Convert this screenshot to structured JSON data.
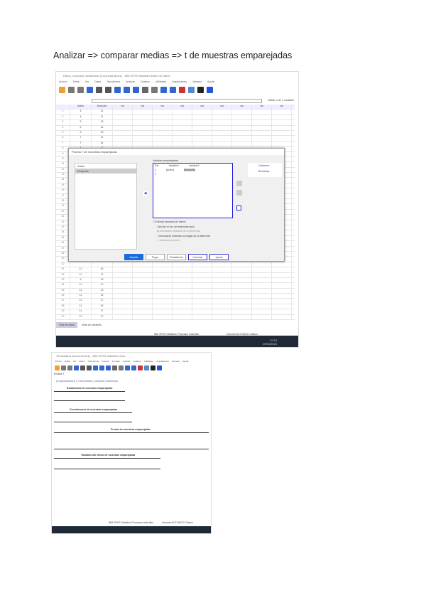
{
  "title": "Analizar => comparar medias =>  t de muestras emparejadas",
  "screenshot1": {
    "window_title": "Datos_comparar medias.sav [ConjuntoDatos1] - IBM SPSS Statistics Editor de datos",
    "menu": [
      "Archivo",
      "Editar",
      "Ver",
      "Datos",
      "Transformar",
      "Analizar",
      "Gráficos",
      "Utilidades",
      "Ampliaciones",
      "Ventana",
      "Ayuda"
    ],
    "visible_label": "Visible: 2 de 2 variables",
    "columns": [
      "Antes",
      "Después",
      "var",
      "var",
      "var",
      "var",
      "var",
      "var",
      "var",
      "var",
      "var"
    ],
    "rows": [
      [
        "1",
        "4",
        "11"
      ],
      [
        "2",
        "4",
        "11"
      ],
      [
        "3",
        "5",
        "13"
      ],
      [
        "4",
        "9",
        "14"
      ],
      [
        "5",
        "9",
        "13"
      ],
      [
        "6",
        "7",
        "11"
      ],
      [
        "7",
        "7",
        "14"
      ],
      [
        "8",
        "4",
        "17"
      ],
      [
        "9",
        "",
        ""
      ],
      [
        "10",
        "",
        ""
      ],
      [
        "11",
        "",
        ""
      ],
      [
        "12",
        "",
        ""
      ],
      [
        "13",
        "",
        ""
      ],
      [
        "14",
        "",
        ""
      ],
      [
        "15",
        "",
        ""
      ],
      [
        "16",
        "",
        ""
      ],
      [
        "17",
        "",
        ""
      ],
      [
        "18",
        "",
        ""
      ],
      [
        "19",
        "",
        ""
      ],
      [
        "20",
        "",
        ""
      ],
      [
        "21",
        "",
        ""
      ],
      [
        "22",
        "",
        ""
      ],
      [
        "23",
        "",
        ""
      ],
      [
        "24",
        "",
        ""
      ],
      [
        "25",
        "",
        ""
      ],
      [
        "26",
        "",
        ""
      ],
      [
        "27",
        "",
        ""
      ],
      [
        "28",
        "",
        ""
      ],
      [
        "29",
        "",
        ""
      ],
      [
        "30",
        "",
        ""
      ],
      [
        "31",
        "11",
        "16"
      ],
      [
        "32",
        "11",
        "17"
      ],
      [
        "33",
        "9",
        "13"
      ],
      [
        "34",
        "11",
        "17"
      ],
      [
        "35",
        "11",
        "13"
      ],
      [
        "36",
        "11",
        "14"
      ],
      [
        "37",
        "11",
        "17"
      ],
      [
        "38",
        "11",
        "16"
      ],
      [
        "39",
        "11",
        "17"
      ],
      [
        "40",
        "11",
        "17"
      ]
    ],
    "tabs": [
      "Vista de datos",
      "Vista de variables"
    ],
    "status": "IBM SPSS Statistics Processor está listo",
    "status_right": "Unicode:ACTIVADO  Clásico",
    "dialog": {
      "title": "Prueba T de muestras emparejadas",
      "source_vars": [
        "Antes",
        "Después"
      ],
      "pairs_label": "Variables emparejadas:",
      "pair_headers": [
        "Par",
        "Variable1",
        "Variable2"
      ],
      "pairs": [
        [
          "1",
          "[Antes]",
          "[Después]"
        ],
        [
          "2",
          "",
          ""
        ]
      ],
      "options_button": "Opciones...",
      "bootstrap_button": "Bootstrap...",
      "effect_checkbox": "Estimar tamaños del efecto",
      "effect_group_label": "Calcular el uso del estandarizador",
      "radios": [
        "Desviación estándar de la diferencia",
        "Desviación estándar corregida de la diferencia",
        "Varianza promedio"
      ],
      "buttons": [
        "Aceptar",
        "Pegar",
        "Restablecer",
        "Cancelar",
        "Ayuda"
      ]
    },
    "taskbar_time": "12:15",
    "taskbar_date": "20/04/2024"
  },
  "screenshot2": {
    "window_title": "*Resultado1 [Documento1] - IBM SPSS Statistics Visor",
    "menu": [
      "Archivo",
      "Editar",
      "Ver",
      "Datos",
      "Transformar",
      "Insertar",
      "Formato",
      "Analizar",
      "Gráficos",
      "Utilidades",
      "Ampliaciones",
      "Ventana",
      "Ayuda"
    ],
    "section": "Prueba T",
    "dataset": "[ConjuntoDatos1] C:\\Users\\Datos_comparar medias.sav",
    "tables": [
      "Estadísticas de muestras emparejadas",
      "Correlaciones de muestras emparejadas",
      "Prueba de muestras emparejadas",
      "Tamaños del efecto de muestras emparejadas"
    ],
    "status": "IBM SPSS Statistics Processor está listo",
    "status_right": "Unicode:ACTIVADO  Clásico"
  }
}
